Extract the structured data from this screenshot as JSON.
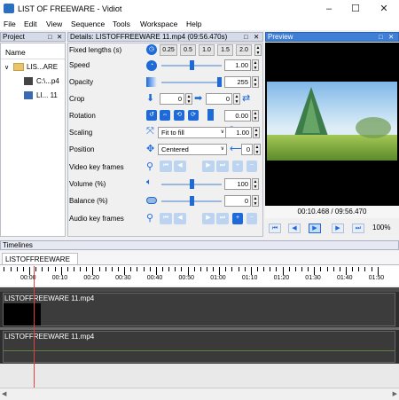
{
  "window": {
    "title": "LIST OF FREEWARE - Vidiot",
    "minimize": "–",
    "maximize": "☐",
    "close": "✕"
  },
  "menu": [
    "File",
    "Edit",
    "View",
    "Sequence",
    "Tools",
    "Workspace",
    "Help"
  ],
  "project": {
    "header": "Project",
    "column": "Name",
    "items": [
      {
        "label": "LIS...ARE"
      },
      {
        "label": "C:\\...p4"
      },
      {
        "label": "LI... 11"
      }
    ]
  },
  "details": {
    "header": "Details: LISTOFFREEWARE 11.mp4 (09:56.470s)",
    "labels": {
      "fixed_lengths": "Fixed lengths (s)",
      "speed": "Speed",
      "opacity": "Opacity",
      "crop": "Crop",
      "rotation": "Rotation",
      "scaling": "Scaling",
      "position": "Position",
      "video_key_frames": "Video key frames",
      "volume": "Volume (%)",
      "balance": "Balance (%)",
      "audio_key_frames": "Audio key frames"
    },
    "fixed_length_options": [
      "0.25",
      "0.5",
      "1.0",
      "1.5",
      "2.0"
    ],
    "speed_value": "1.00",
    "speed_level": 0.5,
    "opacity_value": "255",
    "opacity_level": 1.0,
    "crop_values": [
      "0",
      "0"
    ],
    "rotation_value": "0.00",
    "scaling_mode": "Fit to fill",
    "scaling_value": "1.00",
    "position_mode": "Centered",
    "position_value": "0",
    "volume_value": "100",
    "volume_level": 0.5,
    "balance_value": "0",
    "balance_level": 0.5
  },
  "preview": {
    "header": "Preview",
    "time_current": "00:10.468",
    "time_separator": "/",
    "time_total": "09:56.470",
    "zoom": "100%",
    "transport": [
      "⏮",
      "◀",
      "▶",
      "▶",
      "⏭"
    ]
  },
  "timelines": {
    "header": "Timelines",
    "tab": "LISTOFFREEWARE 11",
    "ruler": [
      "00:00",
      "00:10",
      "00:20",
      "00:30",
      "00:40",
      "00:50",
      "01:00",
      "01:10",
      "01:20",
      "01:30",
      "01:40",
      "01:50"
    ],
    "video_clip": "LISTOFFREEWARE 11.mp4",
    "audio_clip": "LISTOFFREEWARE 11.mp4"
  },
  "icons": {
    "panel_restore": "□",
    "panel_close": "✕"
  }
}
